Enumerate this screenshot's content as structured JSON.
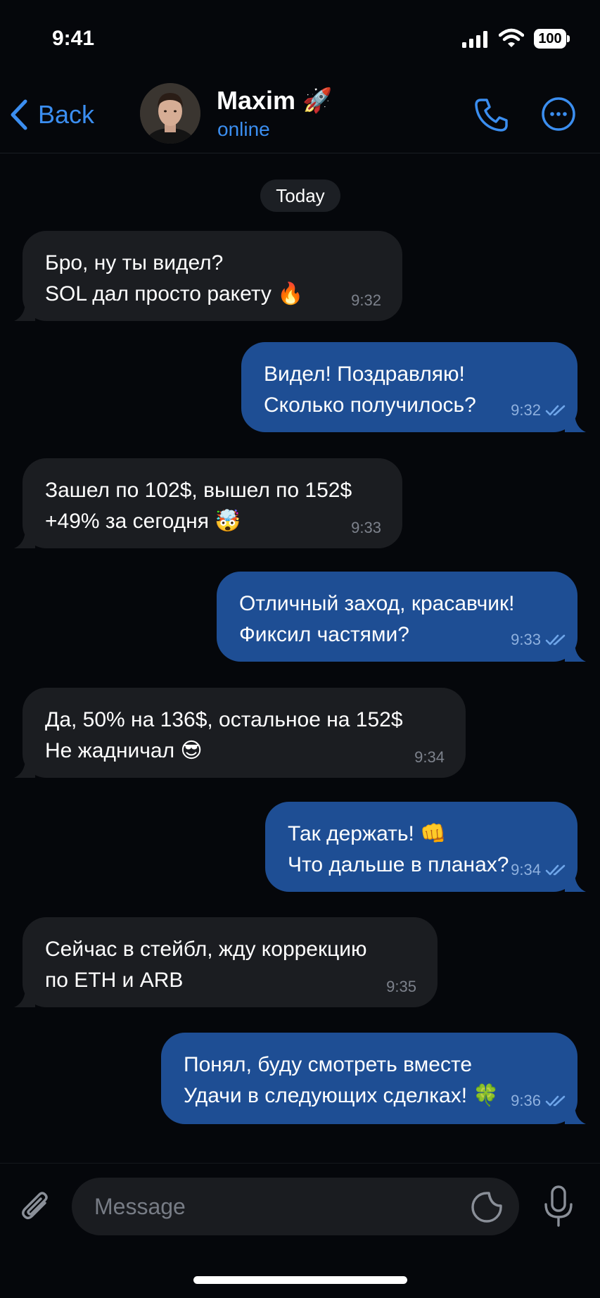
{
  "status_bar": {
    "time": "9:41",
    "battery": "100",
    "icons": [
      "signal-icon",
      "wifi-icon",
      "battery-icon"
    ]
  },
  "header": {
    "back_label": "Back",
    "contact_name": "Maxim",
    "contact_emoji": "🚀",
    "contact_status": "online",
    "icons": [
      "back-chevron-icon",
      "phone-icon",
      "more-icon"
    ]
  },
  "day_label": "Today",
  "messages": [
    {
      "direction": "in",
      "lines": [
        "Бро, ну ты видел?",
        "SOL дал просто ракету 🔥"
      ],
      "time": "9:32"
    },
    {
      "direction": "out",
      "lines": [
        "Видел! Поздравляю!",
        "Сколько получилось?"
      ],
      "time": "9:32",
      "read": true
    },
    {
      "direction": "in",
      "lines": [
        "Зашел по 102$, вышел по 152$",
        "+49% за сегодня 🤯"
      ],
      "time": "9:33"
    },
    {
      "direction": "out",
      "lines": [
        "Отличный заход, красавчик!",
        "Фиксил частями?"
      ],
      "time": "9:33",
      "read": true
    },
    {
      "direction": "in",
      "lines": [
        "Да, 50% на 136$, остальное на 152$",
        "Не жадничал 😎"
      ],
      "time": "9:34"
    },
    {
      "direction": "out",
      "lines": [
        "Так держать! 👊",
        "Что дальше в планах?"
      ],
      "time": "9:34",
      "read": true
    },
    {
      "direction": "in",
      "lines": [
        "Сейчас в стейбл, жду коррекцию",
        "по ETH и ARB"
      ],
      "time": "9:35"
    },
    {
      "direction": "out",
      "lines": [
        "Понял, буду смотреть вместе",
        "Удачи в следующих сделках! 🍀"
      ],
      "time": "9:36",
      "read": true
    }
  ],
  "composer": {
    "placeholder": "Message",
    "icons": [
      "paperclip-icon",
      "sticker-icon",
      "microphone-icon"
    ]
  },
  "colors": {
    "background": "#05070b",
    "incoming_bubble": "#1b1d21",
    "outgoing_bubble": "#1e4e94",
    "accent": "#3b8ef0"
  }
}
